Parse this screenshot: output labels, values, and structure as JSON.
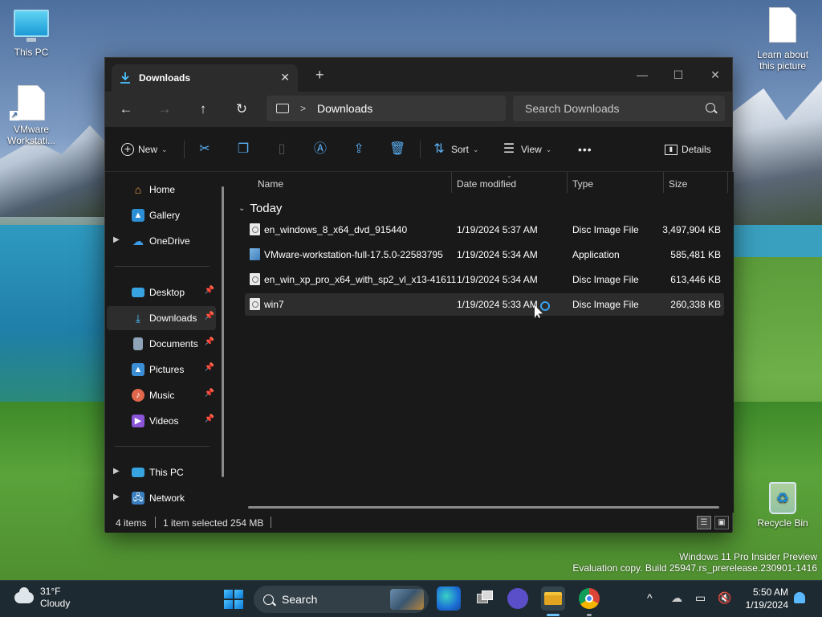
{
  "desktop": {
    "icons": [
      {
        "label": "This PC"
      },
      {
        "label": "VMware Workstati..."
      },
      {
        "label": "Learn about this picture"
      },
      {
        "label": "Recycle Bin"
      }
    ],
    "watermark": {
      "line1": "Windows 11 Pro Insider Preview",
      "line2": "Evaluation copy. Build 25947.rs_prerelease.230901-1416"
    }
  },
  "window": {
    "tab": {
      "title": "Downloads",
      "close": "✕"
    },
    "new_tab": "+",
    "controls": {
      "minimize": "—",
      "maximize": "☐",
      "close": "✕"
    },
    "nav": {
      "back": "←",
      "forward": "→",
      "up": "↑",
      "refresh": "↻",
      "chevron": ">",
      "breadcrumb": "Downloads",
      "search_placeholder": "Search Downloads"
    },
    "toolbar": {
      "new_label": "New",
      "sort_label": "Sort",
      "view_label": "View",
      "more_label": "•••",
      "details_label": "Details"
    },
    "sidebar": {
      "home": "Home",
      "gallery": "Gallery",
      "onedrive": "OneDrive",
      "desktop": "Desktop",
      "downloads": "Downloads",
      "documents": "Documents",
      "pictures": "Pictures",
      "music": "Music",
      "videos": "Videos",
      "thispc": "This PC",
      "network": "Network"
    },
    "columns": {
      "name": "Name",
      "date": "Date modified",
      "type": "Type",
      "size": "Size"
    },
    "group": "Today",
    "files": [
      {
        "name": "en_windows_8_x64_dvd_915440",
        "date": "1/19/2024 5:37 AM",
        "type": "Disc Image File",
        "size": "3,497,904 KB"
      },
      {
        "name": "VMware-workstation-full-17.5.0-22583795",
        "date": "1/19/2024 5:34 AM",
        "type": "Application",
        "size": "585,481 KB"
      },
      {
        "name": "en_win_xp_pro_x64_with_sp2_vl_x13-41611",
        "date": "1/19/2024 5:34 AM",
        "type": "Disc Image File",
        "size": "613,446 KB"
      },
      {
        "name": "win7",
        "date": "1/19/2024 5:33 AM",
        "type": "Disc Image File",
        "size": "260,338 KB"
      }
    ],
    "status": {
      "items": "4 items",
      "selected": "1 item selected  254 MB"
    }
  },
  "taskbar": {
    "weather": {
      "temp": "31°F",
      "condition": "Cloudy"
    },
    "search_label": "Search",
    "time": "5:50 AM",
    "date": "1/19/2024"
  },
  "colors": {
    "accent": "#4cc2ff",
    "window_bg": "#191919",
    "taskbar_bg": "#1e2a31"
  }
}
